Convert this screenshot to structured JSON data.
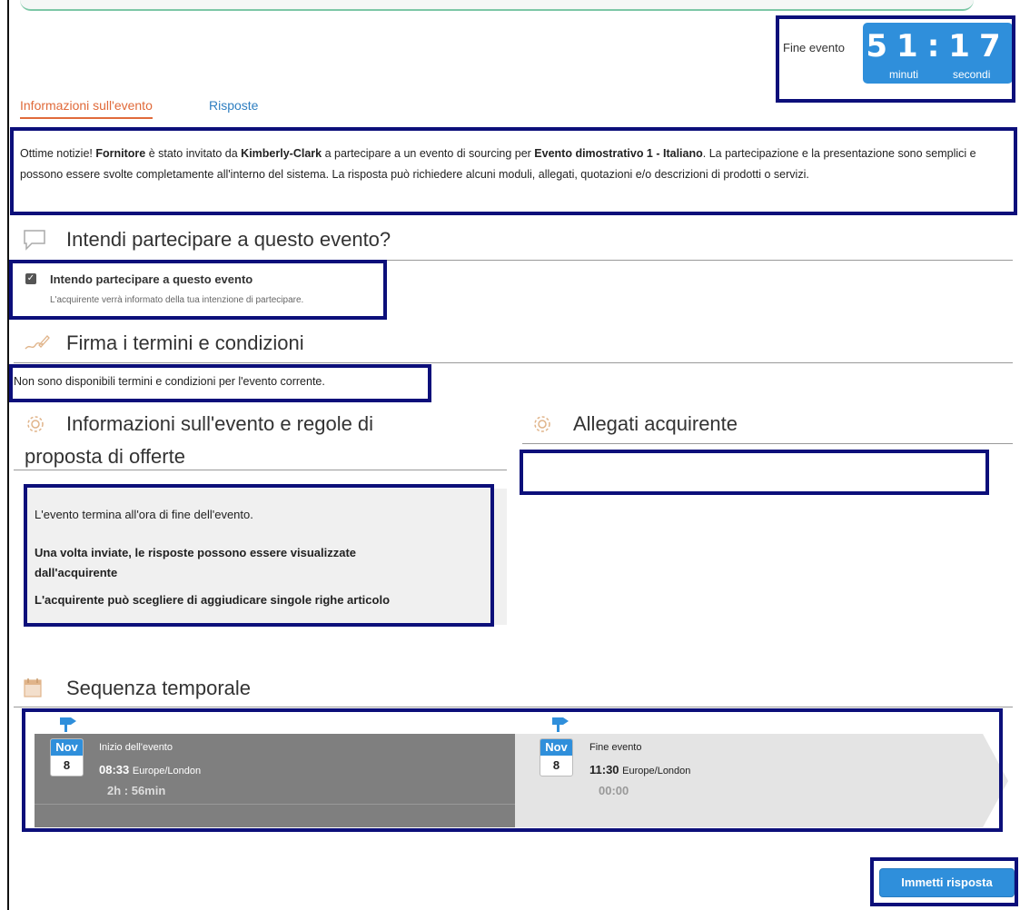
{
  "timer": {
    "label": "Fine evento",
    "display": "51:17",
    "minutes_label": "minuti",
    "seconds_label": "secondi"
  },
  "tabs": [
    {
      "label": "Informazioni sull'evento",
      "active": true
    },
    {
      "label": "Risposte",
      "active": false
    }
  ],
  "intro": {
    "t1": "Ottime notizie! ",
    "supplier": "Fornitore",
    "t2": " è stato invitato da ",
    "buyer": "Kimberly-Clark",
    "t3": " a partecipare a un evento di sourcing per ",
    "event": "Evento dimostrativo 1 - Italiano",
    "t4": ". La partecipazione e la presentazione sono semplici e possono essere svolte completamente all'interno del sistema. La risposta può richiedere alcuni moduli, allegati, quotazioni e/o descrizioni di prodotti o servizi."
  },
  "intent": {
    "title": "Intendi partecipare a questo evento?",
    "checkbox_label": "Intendo partecipare a questo evento",
    "checked": true,
    "help": "L'acquirente verrà informato della tua intenzione di partecipare."
  },
  "terms": {
    "title": "Firma i termini e condizioni",
    "text": "Non sono disponibili termini e condizioni per l'evento corrente."
  },
  "rules": {
    "title_line1": "Informazioni sull'evento e regole di",
    "title_line2": "proposta di offerte",
    "line1": "L'evento termina all'ora di fine dell'evento.",
    "line2a": "Una volta inviate, le risposte possono essere visualizzate",
    "line2b": "dall'acquirente",
    "line3": "L'acquirente può scegliere di aggiudicare singole righe articolo"
  },
  "attachments": {
    "title": "Allegati acquirente"
  },
  "timeline": {
    "title": "Sequenza temporale",
    "start": {
      "month": "Nov",
      "day": "8",
      "name": "Inizio dell'evento",
      "time": "08:33",
      "timezone": "Europe/London",
      "duration": "2h : 56min"
    },
    "end": {
      "month": "Nov",
      "day": "8",
      "name": "Fine evento",
      "time": "11:30",
      "timezone": "Europe/London",
      "duration": "00:00"
    }
  },
  "submit_label": "Immetti risposta",
  "colors": {
    "accent_blue": "#2f8fdb",
    "tab_active": "#e06a3a",
    "highlight_border": "#0c0f7a"
  }
}
